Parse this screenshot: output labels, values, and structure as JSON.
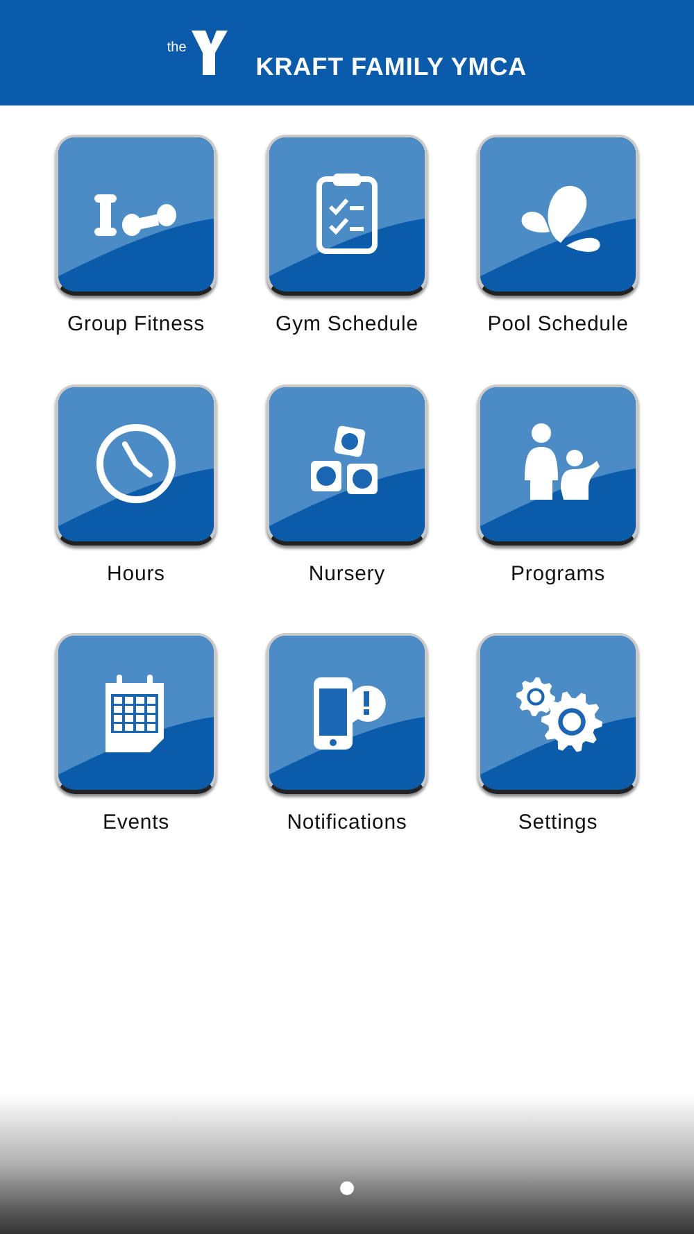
{
  "header": {
    "logo_prefix": "the",
    "title": "KRAFT FAMILY YMCA"
  },
  "tiles": [
    {
      "label": "Group Fitness",
      "kind": "dumbbells"
    },
    {
      "label": "Gym Schedule",
      "kind": "clipboard"
    },
    {
      "label": "Pool Schedule",
      "kind": "drops"
    },
    {
      "label": "Hours",
      "kind": "clock"
    },
    {
      "label": "Nursery",
      "kind": "blocks"
    },
    {
      "label": "Programs",
      "kind": "people"
    },
    {
      "label": "Events",
      "kind": "calendar"
    },
    {
      "label": "Notifications",
      "kind": "phone"
    },
    {
      "label": "Settings",
      "kind": "gears"
    }
  ]
}
